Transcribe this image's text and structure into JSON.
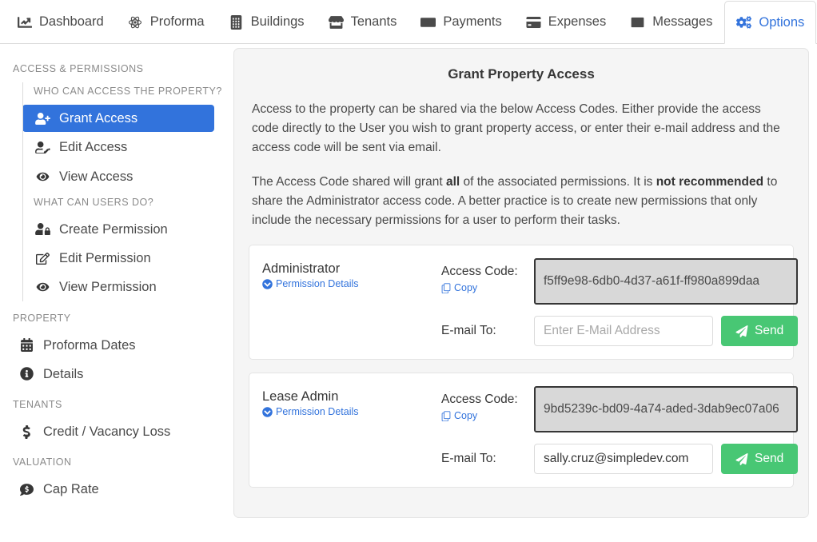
{
  "tabs": [
    {
      "label": "Dashboard",
      "icon": "chart-line-icon",
      "active": false
    },
    {
      "label": "Proforma",
      "icon": "atom-icon",
      "active": false
    },
    {
      "label": "Buildings",
      "icon": "building-icon",
      "active": false
    },
    {
      "label": "Tenants",
      "icon": "store-icon",
      "active": false
    },
    {
      "label": "Payments",
      "icon": "money-bill-icon",
      "active": false
    },
    {
      "label": "Expenses",
      "icon": "credit-card-icon",
      "active": false
    },
    {
      "label": "Messages",
      "icon": "envelope-icon",
      "active": false
    },
    {
      "label": "Options",
      "icon": "cogs-icon",
      "active": true
    }
  ],
  "sidebar": {
    "section_access": "ACCESS & PERMISSIONS",
    "group_who": "WHO CAN ACCESS THE PROPERTY?",
    "group_what": "WHAT CAN USERS DO?",
    "section_property": "PROPERTY",
    "section_tenants": "TENANTS",
    "section_valuation": "VALUATION",
    "who_items": [
      {
        "label": "Grant Access",
        "icon": "user-plus-icon",
        "selected": true
      },
      {
        "label": "Edit Access",
        "icon": "user-edit-icon",
        "selected": false
      },
      {
        "label": "View Access",
        "icon": "eye-icon",
        "selected": false
      }
    ],
    "what_items": [
      {
        "label": "Create Permission",
        "icon": "user-lock-icon",
        "selected": false
      },
      {
        "label": "Edit Permission",
        "icon": "edit-square-icon",
        "selected": false
      },
      {
        "label": "View Permission",
        "icon": "eye-icon",
        "selected": false
      }
    ],
    "property_items": [
      {
        "label": "Proforma Dates",
        "icon": "calendar-icon"
      },
      {
        "label": "Details",
        "icon": "info-circle-icon"
      }
    ],
    "tenants_items": [
      {
        "label": "Credit / Vacancy Loss",
        "icon": "dollar-sign-icon"
      }
    ],
    "valuation_items": [
      {
        "label": "Cap Rate",
        "icon": "comment-dollar-icon"
      }
    ]
  },
  "panel": {
    "title": "Grant Property Access",
    "intro_p1_a": "Access to the property can be shared via the below Access Codes. Either provide the access code directly to the User you wish to grant property access, or enter their e-mail address and the access code will be sent via email.",
    "intro_p2_a": "The Access Code shared will grant ",
    "intro_p2_bold1": "all",
    "intro_p2_b": " of the associated permissions. It is ",
    "intro_p2_bold2": "not recommended",
    "intro_p2_c": " to share the Administrator access code. A better practice is to create new permissions that only include the necessary permissions for a user to perform their tasks.",
    "labels": {
      "access_code": "Access Code:",
      "email_to": "E-mail To:",
      "permission_details": "Permission Details",
      "copy": "Copy",
      "send": "Send"
    },
    "cards": [
      {
        "role": "Administrator",
        "permission_details": "Permission Details",
        "access_code": "f5ff9e98-6db0-4d37-a61f-ff980a899daa",
        "email_value": "",
        "email_placeholder": "Enter E-Mail Address",
        "send_label": "Send"
      },
      {
        "role": "Lease Admin",
        "permission_details": "Permission Details",
        "access_code": "9bd5239c-bd09-4a74-aded-3dab9ec07a06",
        "email_value": "sally.cruz@simpledev.com",
        "email_placeholder": "Enter E-Mail Address",
        "send_label": "Send"
      }
    ]
  },
  "colors": {
    "accent_blue": "#3273dc",
    "success_green": "#48c774",
    "panel_bg": "#f5f5f5",
    "code_bg": "#d8d8d8",
    "text": "#363636",
    "muted": "#8a8a8a"
  }
}
